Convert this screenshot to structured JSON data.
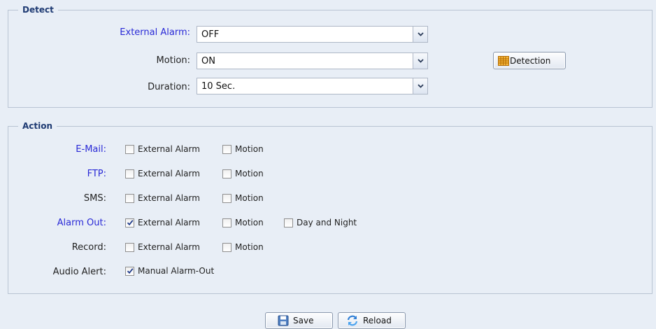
{
  "detect": {
    "title": "Detect",
    "external_alarm": {
      "label": "External Alarm:",
      "value": "OFF"
    },
    "motion": {
      "label": "Motion:",
      "value": "ON"
    },
    "duration": {
      "label": "Duration:",
      "value": "10 Sec."
    },
    "detection_button": "Detection"
  },
  "action": {
    "title": "Action",
    "rows": [
      {
        "label": "E-Mail:",
        "options": [
          {
            "text": "External Alarm",
            "checked": false
          },
          {
            "text": "Motion",
            "checked": false
          }
        ]
      },
      {
        "label": "FTP:",
        "options": [
          {
            "text": "External Alarm",
            "checked": false
          },
          {
            "text": "Motion",
            "checked": false
          }
        ]
      },
      {
        "label": "SMS:",
        "options": [
          {
            "text": "External Alarm",
            "checked": false
          },
          {
            "text": "Motion",
            "checked": false
          }
        ]
      },
      {
        "label": "Alarm Out:",
        "options": [
          {
            "text": "External Alarm",
            "checked": true
          },
          {
            "text": "Motion",
            "checked": false
          },
          {
            "text": "Day and Night",
            "checked": false
          }
        ]
      },
      {
        "label": "Record:",
        "options": [
          {
            "text": "External Alarm",
            "checked": false
          },
          {
            "text": "Motion",
            "checked": false
          }
        ]
      },
      {
        "label": "Audio Alert:",
        "options": [
          {
            "text": "Manual Alarm-Out",
            "checked": true
          }
        ]
      }
    ]
  },
  "buttons": {
    "save": "Save",
    "reload": "Reload"
  },
  "colors": {
    "background": "#e8eef6",
    "link_label": "#2929d6",
    "group_title": "#1f3b73",
    "border": "#b9c4d3"
  },
  "icons": {
    "detection": "grid-icon",
    "save": "floppy-disk-icon",
    "reload": "refresh-icon",
    "dropdown": "chevron-down-icon",
    "checked": "checkmark-icon"
  }
}
